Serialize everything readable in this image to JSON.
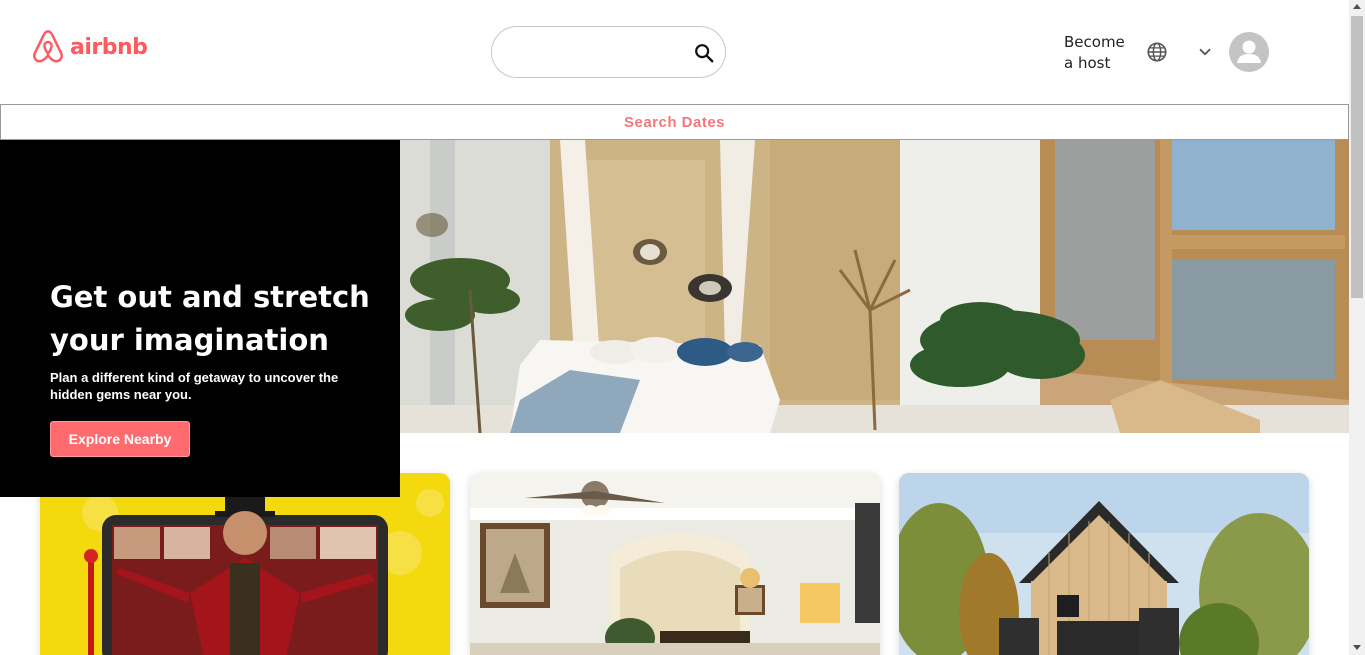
{
  "brand": {
    "name": "airbnb",
    "color": "#ff5a5f"
  },
  "header": {
    "search": {
      "value": "",
      "placeholder": "",
      "icon": "search-icon"
    },
    "host_link": "Become a host",
    "language_icon": "globe-icon",
    "menu_icon": "chevron-down-icon",
    "avatar_icon": "user-avatar-icon"
  },
  "dates_bar": {
    "label": "Search Dates",
    "color": "#f2787b"
  },
  "hero": {
    "title": "Get out and stretch your imagination",
    "subtitle": "Plan a different kind of getaway to uncover the hidden gems near you.",
    "cta_label": "Explore Nearby",
    "cta_color": "#ff6b6f",
    "image": "bedroom-interior-photo"
  },
  "cards": [
    {
      "image": "online-experience-performer-photo"
    },
    {
      "image": "apartment-living-room-photo"
    },
    {
      "image": "wooden-cabin-exterior-photo"
    }
  ]
}
